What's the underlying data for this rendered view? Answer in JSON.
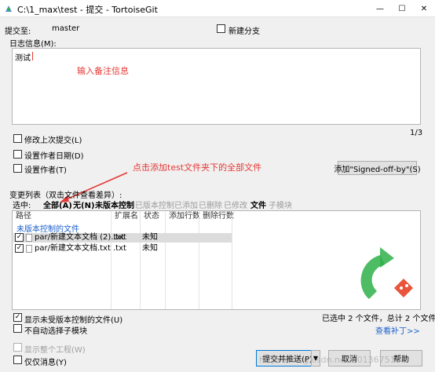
{
  "window": {
    "title": "C:\\1_max\\test - 提交 - TortoiseGit",
    "minimize_glyph": "—",
    "maximize_glyph": "☐",
    "close_glyph": "✕"
  },
  "commit_to": {
    "label": "提交至:",
    "branch": "master",
    "new_branch_label": "新建分支"
  },
  "message": {
    "label": "日志信息(M):",
    "value": "测试",
    "annotation": "输入备注信息",
    "counter": "1/3"
  },
  "options": {
    "amend_label": "修改上次提交(L)",
    "set_date_label": "设置作者日期(D)",
    "set_author_label": "设置作者(T)",
    "signoff_button": "添加\"Signed-off-by\"(S)"
  },
  "annotation2": "点击添加test文件夹下的全部文件",
  "changes": {
    "label": "变更列表（双击文件查看差异）:",
    "select_label": "选中:",
    "filters": [
      {
        "label": "全部(A)",
        "active": true
      },
      {
        "label": "无(N)",
        "active": true
      },
      {
        "label": "未版本控制",
        "active": true
      },
      {
        "label": "已版本控制",
        "active": false
      },
      {
        "label": "已添加",
        "active": false
      },
      {
        "label": "已删除",
        "active": false
      },
      {
        "label": "已修改",
        "active": false
      },
      {
        "label": "文件",
        "active": true
      },
      {
        "label": "子模块",
        "active": false
      }
    ],
    "columns": [
      "路径",
      "扩展名",
      "状态",
      "添加行数",
      "删除行数"
    ],
    "group_label": "未版本控制的文件",
    "files": [
      {
        "path": "par/新建文本文档 (2).txt",
        "ext": ".txt",
        "status": "未知",
        "checked": true
      },
      {
        "path": "par/新建文本文档.txt",
        "ext": ".txt",
        "status": "未知",
        "checked": true
      }
    ]
  },
  "footer": {
    "show_unversioned_label": "显示未受版本控制的文件(U)",
    "no_autoselect_label": "不自动选择子模块",
    "selected_summary": "已选中 2 个文件，总计 2 个文件",
    "view_patch_link": "查看补丁>>",
    "show_whole_project_label": "显示整个工程(W)",
    "message_only_label": "仅仅消息(Y)",
    "commit_button": "提交并推送(P)",
    "cancel_button": "取消",
    "help_button": "帮助",
    "watermark": "https://blog.csdn.net/u013675169"
  },
  "colors": {
    "accent_blue": "#1a5fcc",
    "annotation_red": "#e53935",
    "tortoise_green": "#2fb04a",
    "git_orange": "#e8553b"
  }
}
